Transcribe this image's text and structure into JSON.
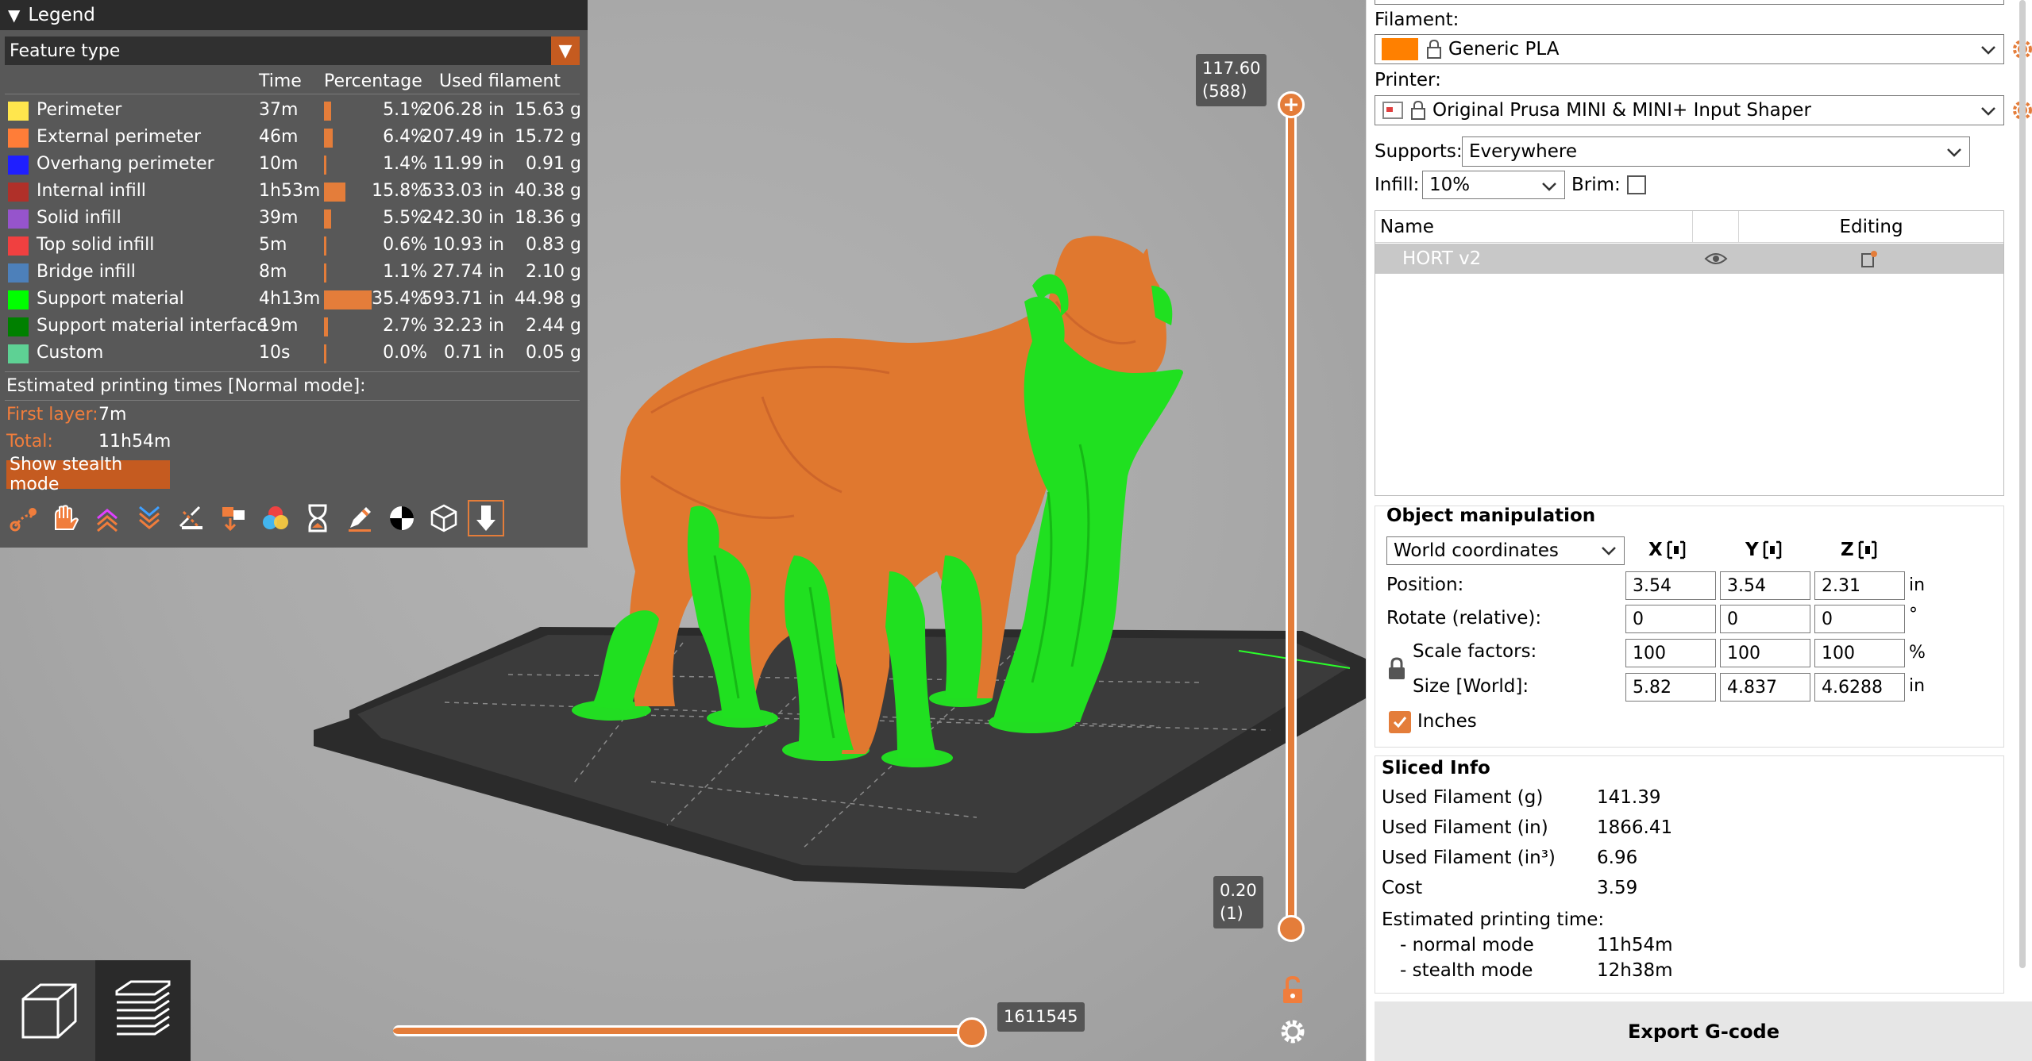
{
  "legend": {
    "title": "Legend",
    "feature_select": "Feature type",
    "headers": {
      "time": "Time",
      "percentage": "Percentage",
      "used_filament": "Used filament"
    },
    "rows": [
      {
        "name": "Perimeter",
        "color": "#ffe64d",
        "time": "37m",
        "pct_value": 5.1,
        "pct": "5.1%",
        "length": "206.28 in",
        "weight": "15.63 g"
      },
      {
        "name": "External perimeter",
        "color": "#ff7d38",
        "time": "46m",
        "pct_value": 6.4,
        "pct": "6.4%",
        "length": "207.49 in",
        "weight": "15.72 g"
      },
      {
        "name": "Overhang perimeter",
        "color": "#1f1fff",
        "time": "10m",
        "pct_value": 1.4,
        "pct": "1.4%",
        "length": "11.99 in",
        "weight": "0.91 g"
      },
      {
        "name": "Internal infill",
        "color": "#b03029",
        "time": "1h53m",
        "pct_value": 15.8,
        "pct": "15.8%",
        "length": "533.03 in",
        "weight": "40.38 g"
      },
      {
        "name": "Solid infill",
        "color": "#9654cc",
        "time": "39m",
        "pct_value": 5.5,
        "pct": "5.5%",
        "length": "242.30 in",
        "weight": "18.36 g"
      },
      {
        "name": "Top solid infill",
        "color": "#f04040",
        "time": "5m",
        "pct_value": 0.6,
        "pct": "0.6%",
        "length": "10.93 in",
        "weight": "0.83 g"
      },
      {
        "name": "Bridge infill",
        "color": "#4d80ba",
        "time": "8m",
        "pct_value": 1.1,
        "pct": "1.1%",
        "length": "27.74 in",
        "weight": "2.10 g"
      },
      {
        "name": "Support material",
        "color": "#00ff00",
        "time": "4h13m",
        "pct_value": 35.4,
        "pct": "35.4%",
        "length": "593.71 in",
        "weight": "44.98 g"
      },
      {
        "name": "Support material interface",
        "color": "#008000",
        "time": "19m",
        "pct_value": 2.7,
        "pct": "2.7%",
        "length": "32.23 in",
        "weight": "2.44 g"
      },
      {
        "name": "Custom",
        "color": "#5ed194",
        "time": "10s",
        "pct_value": 0.0,
        "pct": "0.0%",
        "length": "0.71 in",
        "weight": "0.05 g"
      }
    ],
    "estimated_title": "Estimated printing times [Normal mode]:",
    "first_layer_label": "First layer:",
    "first_layer_value": "7m",
    "total_label": "Total:",
    "total_value": "11h54m",
    "stealth_button": "Show stealth mode",
    "icons": [
      "travel-icon",
      "wipe-icon",
      "retractions-icon",
      "deretractions-icon",
      "seams-icon",
      "tool-changes-icon",
      "color-changes-icon",
      "pause-icon",
      "custom-gcode-icon",
      "center-of-gravity-icon",
      "shells-icon",
      "tool-marker-icon"
    ]
  },
  "vertical_slider": {
    "top_value": "117.60",
    "top_layer": "(588)",
    "bottom_value": "0.20",
    "bottom_layer": "(1)"
  },
  "horizontal_slider": {
    "value": "1611545"
  },
  "view_buttons": [
    "3d-view-icon",
    "layers-view-icon"
  ],
  "panel": {
    "filament_label": "Filament:",
    "filament_value": "Generic PLA",
    "filament_color": "#ff8000",
    "printer_label": "Printer:",
    "printer_value": "Original Prusa MINI & MINI+ Input Shaper",
    "supports_label": "Supports:",
    "supports_value": "Everywhere",
    "infill_label": "Infill:",
    "infill_value": "10%",
    "brim_label": "Brim:",
    "brim_checked": false,
    "list_headers": {
      "name": "Name",
      "editing": "Editing"
    },
    "object_name": "HORT v2",
    "manip_title": "Object manipulation",
    "coords_value": "World coordinates",
    "axes": [
      "X",
      "Y",
      "Z"
    ],
    "position_label": "Position:",
    "position": [
      "3.54",
      "3.54",
      "2.31"
    ],
    "position_unit": "in",
    "rotate_label": "Rotate (relative):",
    "rotate": [
      "0",
      "0",
      "0"
    ],
    "rotate_unit": "°",
    "scale_label": "Scale factors:",
    "scale": [
      "100",
      "100",
      "100"
    ],
    "scale_unit": "%",
    "size_label": "Size [World]:",
    "size": [
      "5.82",
      "4.837",
      "4.6288"
    ],
    "size_unit": "in",
    "inches_label": "Inches",
    "inches_checked": true,
    "sliced_title": "Sliced Info",
    "sliced": [
      {
        "label": "Used Filament (g)",
        "value": "141.39"
      },
      {
        "label": "Used Filament (in)",
        "value": "1866.41"
      },
      {
        "label": "Used Filament (in³)",
        "value": "6.96"
      },
      {
        "label": "Cost",
        "value": "3.59"
      }
    ],
    "est_time_label": "Estimated printing time:",
    "normal_label": "- normal mode",
    "normal_value": "11h54m",
    "stealth_label": "- stealth mode",
    "stealth_value": "12h38m",
    "export_button": "Export G-code"
  }
}
